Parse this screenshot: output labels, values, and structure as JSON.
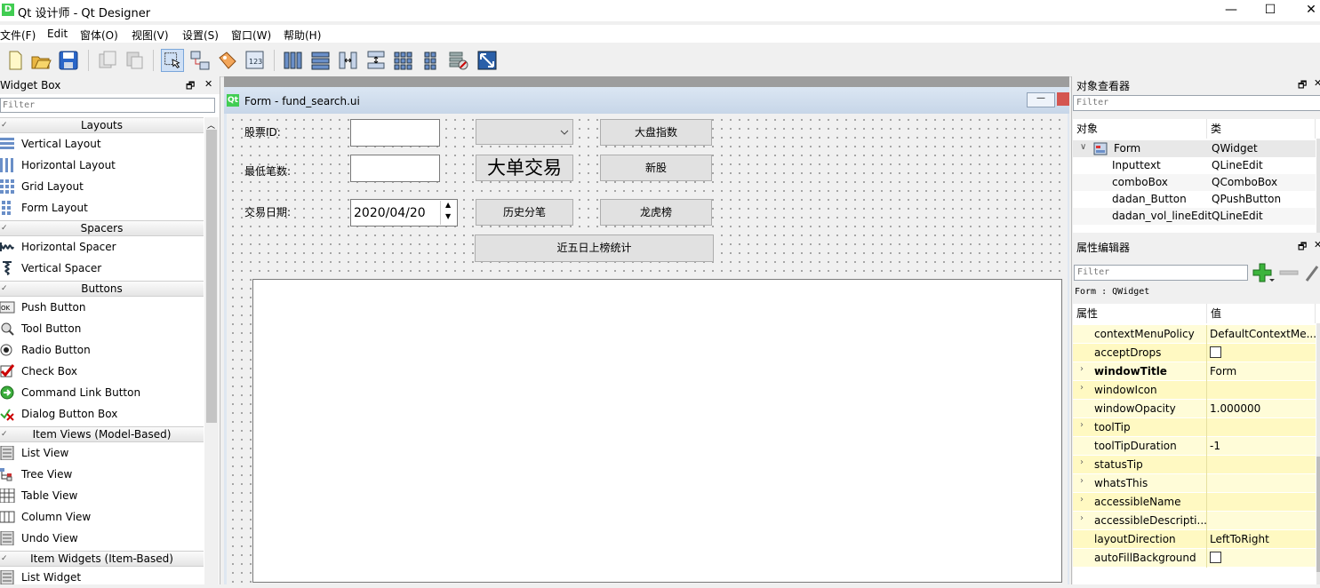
{
  "window": {
    "app_icon_letter": "D",
    "title": "Qt 设计师 - Qt Designer",
    "minimize": "—",
    "maximize": "☐",
    "close": "✕"
  },
  "menubar": [
    "文件(F)",
    "Edit",
    "窗体(O)",
    "视图(V)",
    "设置(S)",
    "窗口(W)",
    "帮助(H)"
  ],
  "widget_box": {
    "title": "Widget Box",
    "filter_placeholder": "Filter",
    "categories": {
      "layouts": "Layouts",
      "spacers": "Spacers",
      "buttons": "Buttons",
      "item_views": "Item Views (Model-Based)",
      "item_widgets": "Item Widgets (Item-Based)"
    },
    "items": {
      "vertical_layout": "Vertical Layout",
      "horizontal_layout": "Horizontal Layout",
      "grid_layout": "Grid Layout",
      "form_layout": "Form Layout",
      "horizontal_spacer": "Horizontal Spacer",
      "vertical_spacer": "Vertical Spacer",
      "push_button": "Push Button",
      "tool_button": "Tool Button",
      "radio_button": "Radio Button",
      "check_box": "Check Box",
      "command_link_button": "Command Link Button",
      "dialog_button_box": "Dialog Button Box",
      "list_view": "List View",
      "tree_view": "Tree View",
      "table_view": "Table View",
      "column_view": "Column View",
      "undo_view": "Undo View",
      "list_widget": "List Widget"
    }
  },
  "form": {
    "title": "Form - fund_search.ui",
    "icon_letter": "Qt",
    "label_stock_id": "股票ID:",
    "label_min_count": "最低笔数:",
    "label_trade_date": "交易日期:",
    "date_value": "2020/04/20",
    "btn_dapan": "大盘指数",
    "btn_dadan": "大单交易",
    "btn_xingu": "新股",
    "btn_history": "历史分笔",
    "btn_longhu": "龙虎榜",
    "btn_five_day": "近五日上榜统计"
  },
  "object_inspector": {
    "title": "对象查看器",
    "filter_placeholder": "Filter",
    "col_object": "对象",
    "col_class": "类",
    "rows": [
      {
        "name": "Form",
        "cls": "QWidget"
      },
      {
        "name": "Inputtext",
        "cls": "QLineEdit"
      },
      {
        "name": "comboBox",
        "cls": "QComboBox"
      },
      {
        "name": "dadan_Button",
        "cls": "QPushButton"
      },
      {
        "name": "dadan_vol_lineEdit",
        "cls": "QLineEdit"
      }
    ]
  },
  "property_editor": {
    "title": "属性编辑器",
    "filter_placeholder": "Filter",
    "object_label": "Form : QWidget",
    "col_property": "属性",
    "col_value": "值",
    "rows": [
      {
        "name": "contextMenuPolicy",
        "value": "DefaultContextMe..."
      },
      {
        "name": "acceptDrops",
        "value": ""
      },
      {
        "name": "windowTitle",
        "value": "Form"
      },
      {
        "name": "windowIcon",
        "value": ""
      },
      {
        "name": "windowOpacity",
        "value": "1.000000"
      },
      {
        "name": "toolTip",
        "value": ""
      },
      {
        "name": "toolTipDuration",
        "value": "-1"
      },
      {
        "name": "statusTip",
        "value": ""
      },
      {
        "name": "whatsThis",
        "value": ""
      },
      {
        "name": "accessibleName",
        "value": ""
      },
      {
        "name": "accessibleDescripti...",
        "value": ""
      },
      {
        "name": "layoutDirection",
        "value": "LeftToRight"
      },
      {
        "name": "autoFillBackground",
        "value": ""
      }
    ]
  },
  "colors": {
    "qt_green": "#41cd52",
    "property_row": "#fffcd8",
    "property_row_alt": "#fff9c2"
  }
}
